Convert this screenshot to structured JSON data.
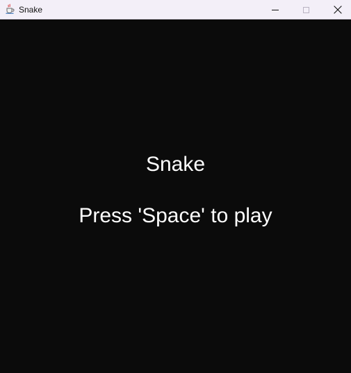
{
  "window": {
    "title": "Snake",
    "app_icon": "java-cup-icon"
  },
  "game": {
    "title": "Snake",
    "prompt": "Press 'Space' to play",
    "background_color": "#0b0b0b",
    "text_color": "#ffffff"
  },
  "controls": {
    "minimize_icon": "minimize-icon",
    "maximize_icon": "maximize-icon",
    "close_icon": "close-icon"
  }
}
